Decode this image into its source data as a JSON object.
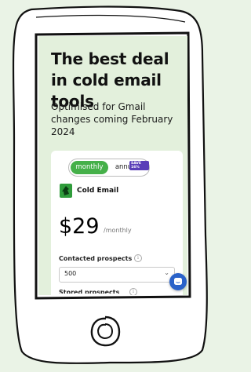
{
  "hero": {
    "title": "The best deal in cold email tools",
    "subtitle": "Optimised for Gmail changes coming February 2024"
  },
  "pricing": {
    "toggle": {
      "monthly_label": "monthly",
      "annually_label": "annually",
      "save_badge": "SAVE 16%",
      "selected": "monthly"
    },
    "product": {
      "name": "Cold Email",
      "icon": "cold-email-logo-icon"
    },
    "price": "$29",
    "period": "/monthly",
    "contacted_prospects": {
      "label": "Contacted prospects",
      "value": "500"
    },
    "stored_prospects": {
      "label": "Stored prospects"
    }
  },
  "chat": {
    "icon": "chat-bubble-icon"
  },
  "colors": {
    "accent_green": "#45b049",
    "badge_purple": "#5a3fb8",
    "chat_blue": "#2a62c9",
    "background": "#eaf3e6"
  }
}
